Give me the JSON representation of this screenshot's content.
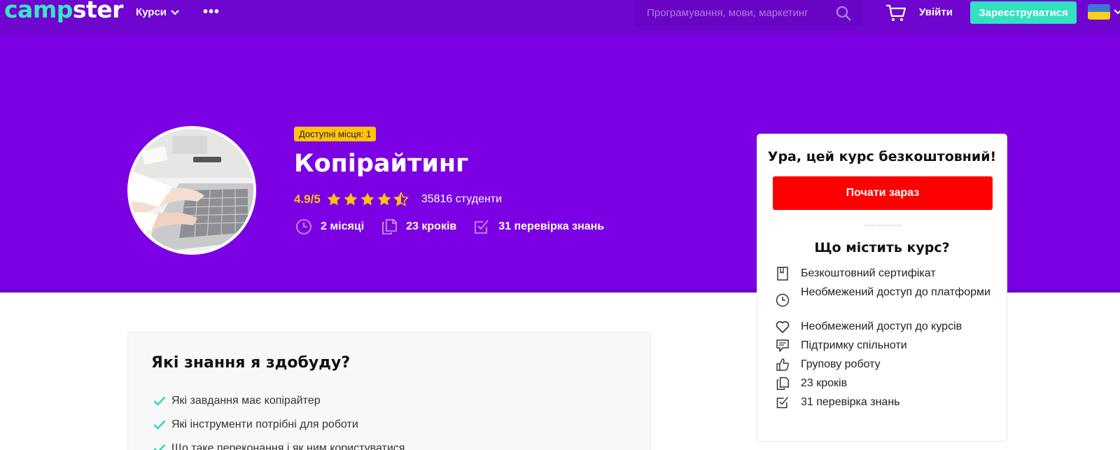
{
  "header": {
    "logo_part1": "camp",
    "logo_part2": "ster",
    "courses_label": "Курси",
    "more_label": "•••",
    "search_placeholder": "Програмування, мови, маркетинг",
    "login_label": "Увійти",
    "register_label": "Зареєструватися",
    "language_flag": "ukraine-flag"
  },
  "course": {
    "availability_badge": "Доступні місця: 1",
    "title": "Копірайтинг",
    "rating": "4.9/5",
    "rating_stars": 4.5,
    "students": "35816 студенти",
    "meta": [
      {
        "icon": "clock-icon",
        "label": "2 місяці"
      },
      {
        "icon": "pages-icon",
        "label": "23 кроків"
      },
      {
        "icon": "checkbox-icon",
        "label": "31 перевірка знань"
      }
    ]
  },
  "card": {
    "title": "Ура, цей курс безкоштовний!",
    "start_button": "Почати зараз",
    "includes_title": "Що містить курс?",
    "includes": [
      {
        "icon": "certificate-icon",
        "label": "Безкоштовний сертифікат"
      },
      {
        "icon": "clock-icon",
        "label": "Необмежений доступ до платформи"
      },
      {
        "icon": "heart-icon",
        "label": "Необмежений доступ до курсів"
      },
      {
        "icon": "chat-icon",
        "label": "Підтримку спільноти"
      },
      {
        "icon": "thumbs-up-icon",
        "label": "Групову роботу"
      },
      {
        "icon": "pages-icon",
        "label": "23 кроків"
      },
      {
        "icon": "checkbox-icon",
        "label": "31 перевірка знань"
      }
    ]
  },
  "knowledge": {
    "title": "Які знання я здобуду?",
    "items": [
      "Які завдання має копірайтер",
      "Які інструменти потрібні для роботи",
      "Що таке переконання і як ним користуватися"
    ]
  },
  "colors": {
    "header_bg": "#6e06cf",
    "hero_bg": "#7b00e4",
    "accent_teal": "#33e0c0",
    "badge_yellow": "#ffc20e",
    "cta_red": "#ff0000"
  }
}
